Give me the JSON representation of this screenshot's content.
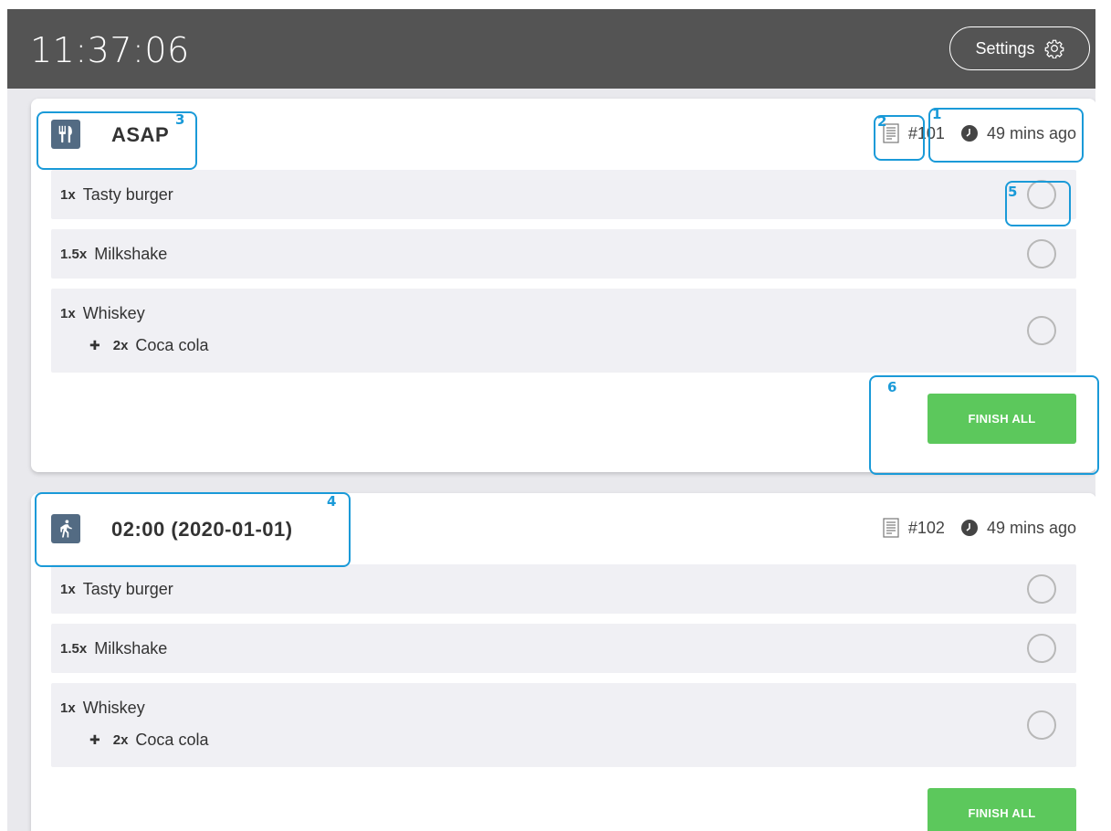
{
  "header": {
    "clock": "11:37:06",
    "settings_label": "Settings",
    "settings_icon": "gear-icon"
  },
  "orders": [
    {
      "type_icon": "cutlery-icon",
      "title": "ASAP",
      "order_number": "#101",
      "age": "49 mins ago",
      "items": [
        {
          "qty": "1x",
          "name": "Tasty burger"
        },
        {
          "qty": "1.5x",
          "name": "Milkshake"
        },
        {
          "qty": "1x",
          "name": "Whiskey",
          "extras": [
            {
              "qty": "2x",
              "name": "Coca cola"
            }
          ]
        }
      ],
      "finish_label": "FINISH ALL"
    },
    {
      "type_icon": "walking-person-icon",
      "title": "02:00 (2020-01-01)",
      "order_number": "#102",
      "age": "49 mins ago",
      "items": [
        {
          "qty": "1x",
          "name": "Tasty burger"
        },
        {
          "qty": "1.5x",
          "name": "Milkshake"
        },
        {
          "qty": "1x",
          "name": "Whiskey",
          "extras": [
            {
              "qty": "2x",
              "name": "Coca cola"
            }
          ]
        }
      ],
      "finish_label": "FINISH ALL"
    }
  ],
  "annotations": [
    "1",
    "2",
    "3",
    "4",
    "5",
    "6"
  ],
  "colors": {
    "topbar": "#545454",
    "background": "#e9e9ed",
    "card": "#ffffff",
    "item_row": "#f0f0f4",
    "type_icon_bg": "#536b83",
    "finish_button": "#5cc85c",
    "annotation": "#1a9ad8"
  }
}
